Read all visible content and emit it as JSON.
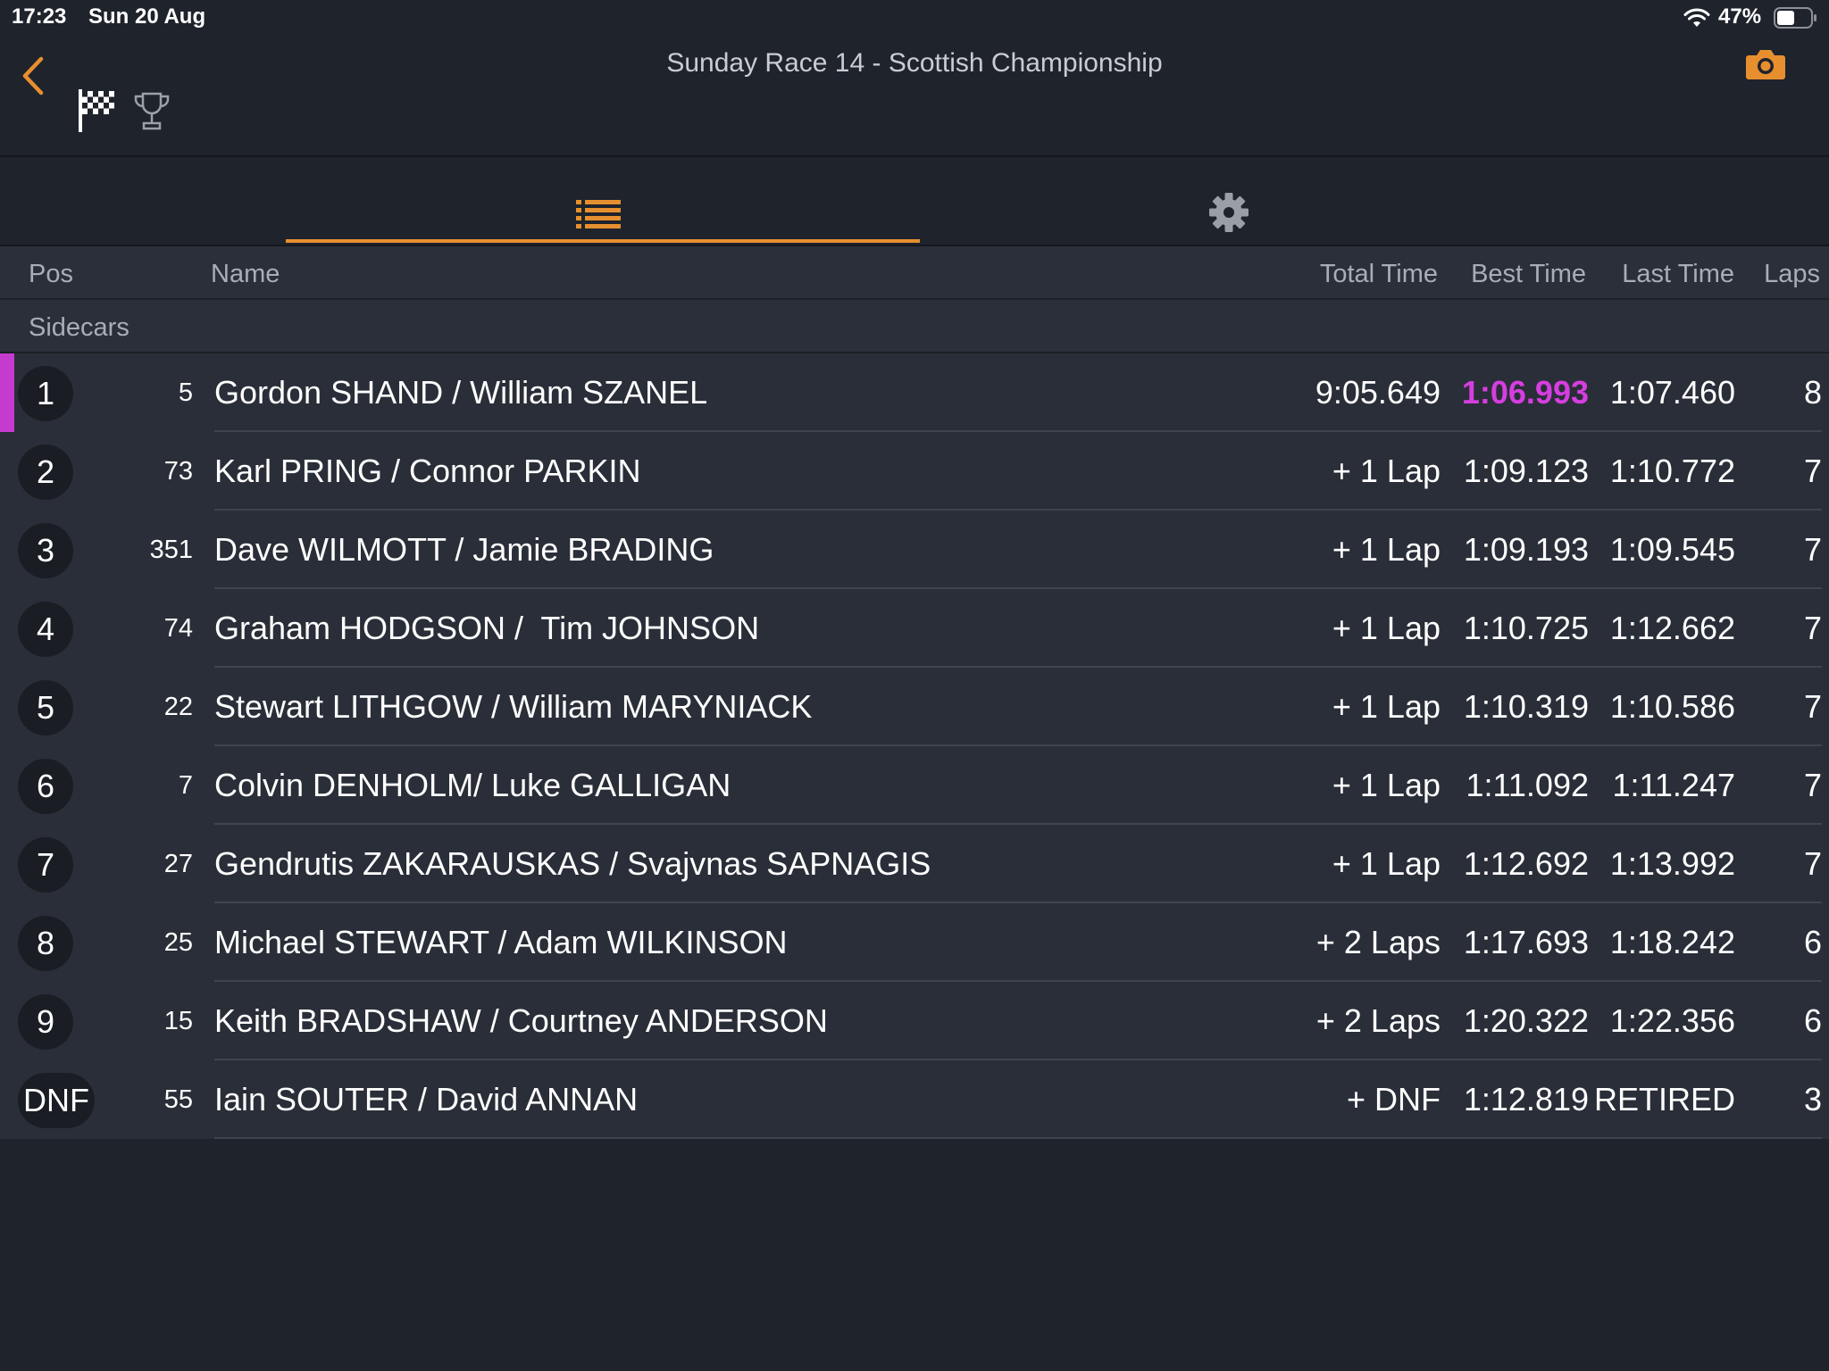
{
  "status_bar": {
    "time": "17:23",
    "date": "Sun 20 Aug",
    "battery_percent": "47%"
  },
  "header": {
    "title": "Sunday Race 14 - Scottish Championship"
  },
  "colors": {
    "accent": "#e78f2f",
    "fastest_lap": "#d63ee0",
    "leader_marker": "#c53bd0",
    "background": "#1f232c",
    "row": "#2a2e38"
  },
  "icons": {
    "back": "back-chevron-icon",
    "flag": "checkered-flag-icon",
    "trophy": "trophy-icon",
    "camera": "camera-icon",
    "list": "list-icon",
    "settings": "gear-icon"
  },
  "columns": {
    "pos": "Pos",
    "name": "Name",
    "total": "Total Time",
    "best": "Best Time",
    "last": "Last Time",
    "laps": "Laps"
  },
  "section": "Sidecars",
  "results": [
    {
      "pos": "1",
      "num": "5",
      "name": "Gordon SHAND / William SZANEL",
      "total": "9:05.649",
      "best": "1:06.993",
      "last": "1:07.460",
      "laps": "8",
      "fastest": true
    },
    {
      "pos": "2",
      "num": "73",
      "name": "Karl PRING / Connor PARKIN",
      "total": "+ 1 Lap",
      "best": "1:09.123",
      "last": "1:10.772",
      "laps": "7"
    },
    {
      "pos": "3",
      "num": "351",
      "name": "Dave WILMOTT / Jamie BRADING",
      "total": "+ 1 Lap",
      "best": "1:09.193",
      "last": "1:09.545",
      "laps": "7"
    },
    {
      "pos": "4",
      "num": "74",
      "name": "Graham HODGSON /  Tim JOHNSON",
      "total": "+ 1 Lap",
      "best": "1:10.725",
      "last": "1:12.662",
      "laps": "7"
    },
    {
      "pos": "5",
      "num": "22",
      "name": "Stewart LITHGOW / William MARYNIACK",
      "total": "+ 1 Lap",
      "best": "1:10.319",
      "last": "1:10.586",
      "laps": "7"
    },
    {
      "pos": "6",
      "num": "7",
      "name": "Colvin DENHOLM/ Luke GALLIGAN",
      "total": "+ 1 Lap",
      "best": "1:11.092",
      "last": "1:11.247",
      "laps": "7"
    },
    {
      "pos": "7",
      "num": "27",
      "name": "Gendrutis ZAKARAUSKAS / Svajvnas SAPNAGIS",
      "total": "+ 1 Lap",
      "best": "1:12.692",
      "last": "1:13.992",
      "laps": "7"
    },
    {
      "pos": "8",
      "num": "25",
      "name": "Michael STEWART / Adam WILKINSON",
      "total": "+ 2 Laps",
      "best": "1:17.693",
      "last": "1:18.242",
      "laps": "6"
    },
    {
      "pos": "9",
      "num": "15",
      "name": "Keith BRADSHAW / Courtney ANDERSON",
      "total": "+ 2 Laps",
      "best": "1:20.322",
      "last": "1:22.356",
      "laps": "6"
    },
    {
      "pos": "DNF",
      "num": "55",
      "name": "Iain SOUTER / David ANNAN",
      "total": "+ DNF",
      "best": "1:12.819",
      "last": "RETIRED",
      "laps": "3"
    }
  ]
}
